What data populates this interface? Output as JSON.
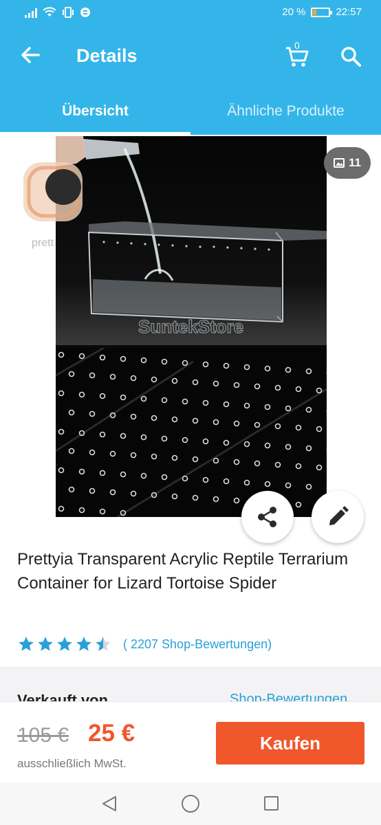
{
  "status_bar": {
    "battery": "20 %",
    "time": "22:57",
    "battery_level": 0.2
  },
  "app_bar": {
    "title": "Details",
    "cart_count": "0",
    "back_icon": "arrow-left-icon",
    "cart_icon": "cart-icon",
    "search_icon": "search-icon"
  },
  "tabs": [
    {
      "label": "Übersicht",
      "active": true
    },
    {
      "label": "Ähnliche Produkte",
      "active": false
    }
  ],
  "product": {
    "image_count": "11",
    "image_watermark": "SuntekStore",
    "brand_partial": "prett",
    "title": "Prettyia Transparent Acrylic Reptile Terrarium Container for Lizard Tortoise Spider",
    "rating_value": 4.5,
    "rating_count": "( 2207 Shop-Bewertungen)"
  },
  "seller": {
    "sold_by_label": "Verkauft von",
    "shop_ratings_link": "Shop-Bewertungen"
  },
  "buy_bar": {
    "old_price": "105 €",
    "new_price": "25 €",
    "tax_note": "ausschließlich MwSt.",
    "buy_label": "Kaufen"
  },
  "colors": {
    "primary": "#33b5e9",
    "accent": "#f0572a",
    "link": "#2a9fd8",
    "star": "#2a9fd8"
  }
}
